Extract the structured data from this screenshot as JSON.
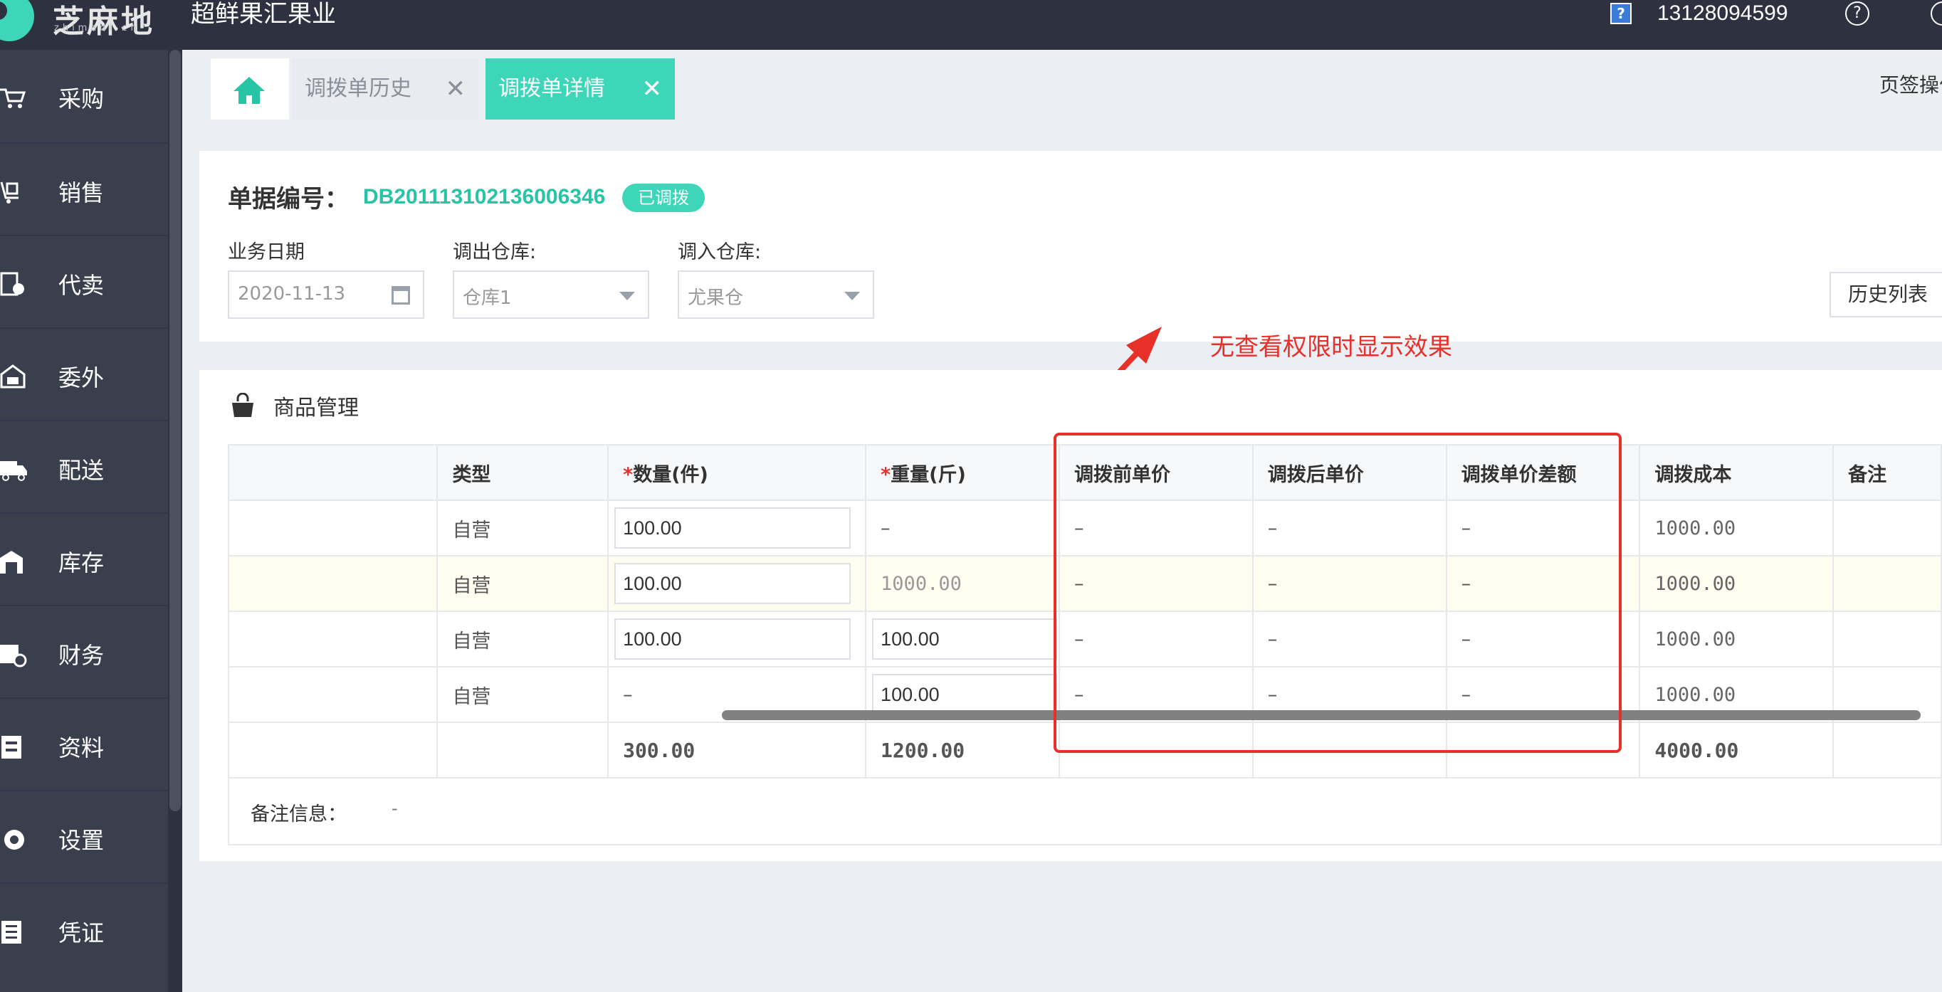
{
  "header": {
    "logo_text": "芝麻地",
    "logo_sub": "zhimadi.cn",
    "company": "超鲜果汇果业",
    "help_box": "?",
    "phone": "13128094599",
    "help": "?"
  },
  "sidebar": {
    "items": [
      {
        "label": "采购",
        "icon": "cart-icon"
      },
      {
        "label": "销售",
        "icon": "trolley-icon"
      },
      {
        "label": "代卖",
        "icon": "consign-icon"
      },
      {
        "label": "委外",
        "icon": "outsource-icon"
      },
      {
        "label": "配送",
        "icon": "truck-icon"
      },
      {
        "label": "库存",
        "icon": "warehouse-icon"
      },
      {
        "label": "财务",
        "icon": "finance-icon"
      },
      {
        "label": "资料",
        "icon": "data-icon"
      },
      {
        "label": "设置",
        "icon": "gear-icon"
      },
      {
        "label": "凭证",
        "icon": "voucher-icon"
      }
    ]
  },
  "tabs": [
    {
      "label": "调拨单历史",
      "close": "✕"
    },
    {
      "label": "调拨单详情",
      "close": "✕"
    }
  ],
  "page_ops": "页签操作",
  "bill": {
    "label": "单据编号：",
    "number": "DB201113102136006346",
    "status": "已调拨"
  },
  "form": {
    "date_label": "业务日期",
    "date_value": "2020-11-13",
    "out_label": "调出仓库:",
    "out_value": "仓库1",
    "in_label": "调入仓库:",
    "in_value": "尤果仓"
  },
  "history_button": "历史列表",
  "annotation": "无查看权限时显示效果",
  "goods": {
    "title": "商品管理",
    "columns": {
      "type": "类型",
      "qty_star": "*",
      "qty": "数量(件)",
      "weight_star": "*",
      "weight": "重量(斤)",
      "price_before": "调拨前单价",
      "price_after": "调拨后单价",
      "price_diff": "调拨单价差额",
      "cost": "调拨成本",
      "remark": "备注"
    },
    "rows": [
      {
        "type": "自营",
        "qty": "100.00",
        "weight": "–",
        "before": "–",
        "after": "–",
        "diff": "–",
        "cost": "1000.00"
      },
      {
        "type": "自营",
        "qty": "100.00",
        "weight": "1000.00",
        "before": "–",
        "after": "–",
        "diff": "–",
        "cost": "1000.00"
      },
      {
        "type": "自营",
        "qty": "100.00",
        "weight": "100.00",
        "before": "–",
        "after": "–",
        "diff": "–",
        "cost": "1000.00"
      },
      {
        "type": "自营",
        "qty": "–",
        "weight": "100.00",
        "before": "–",
        "after": "–",
        "diff": "–",
        "cost": "1000.00"
      }
    ],
    "totals": {
      "qty": "300.00",
      "weight": "1200.00",
      "cost": "4000.00"
    },
    "remark_label": "备注信息：",
    "remark_value": "-"
  }
}
